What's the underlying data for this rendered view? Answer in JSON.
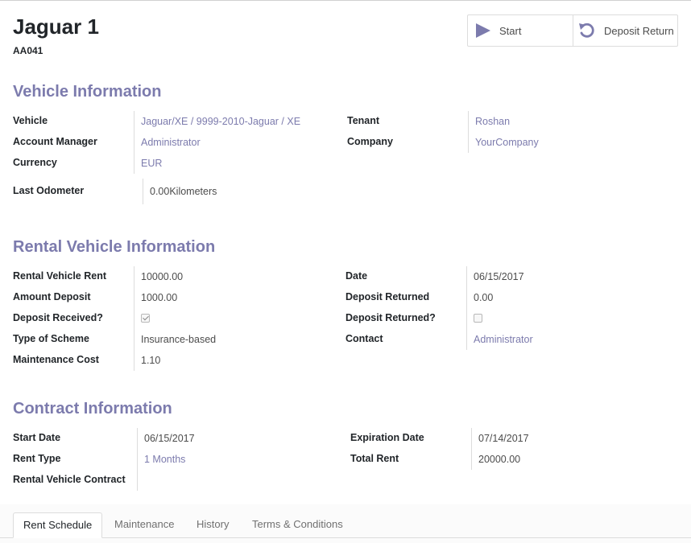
{
  "header": {
    "title": "Jaguar 1",
    "reference": "AA041"
  },
  "buttons": {
    "start_label": "Start",
    "deposit_return_label": "Deposit Return"
  },
  "colors": {
    "accent": "#7c7bad",
    "text": "#4c4c4c",
    "heading": "#212529"
  },
  "vehicle_info": {
    "heading": "Vehicle Information",
    "vehicle_label": "Vehicle",
    "vehicle_value": "Jaguar/XE / 9999-2010-Jaguar / XE",
    "account_manager_label": "Account Manager",
    "account_manager_value": "Administrator",
    "currency_label": "Currency",
    "currency_value": "EUR",
    "tenant_label": "Tenant",
    "tenant_value": "Roshan",
    "company_label": "Company",
    "company_value": "YourCompany",
    "odometer_label": "Last Odometer",
    "odometer_value": "0.00",
    "odometer_unit": "Kilometers"
  },
  "rental_info": {
    "heading": "Rental Vehicle Information",
    "rent_label": "Rental Vehicle Rent",
    "rent_value": "10000.00",
    "amount_deposit_label": "Amount Deposit",
    "amount_deposit_value": "1000.00",
    "deposit_received_label": "Deposit Received?",
    "deposit_received_checked": true,
    "scheme_label": "Type of Scheme",
    "scheme_value": "Insurance-based",
    "maintenance_cost_label": "Maintenance Cost",
    "maintenance_cost_value": "1.10",
    "date_label": "Date",
    "date_value": "06/15/2017",
    "deposit_returned_amt_label": "Deposit Returned",
    "deposit_returned_amt_value": "0.00",
    "deposit_returned_q_label": "Deposit Returned?",
    "deposit_returned_checked": false,
    "contact_label": "Contact",
    "contact_value": "Administrator"
  },
  "contract_info": {
    "heading": "Contract Information",
    "start_date_label": "Start Date",
    "start_date_value": "06/15/2017",
    "rent_type_label": "Rent Type",
    "rent_type_value": "1 Months",
    "contract_label": "Rental Vehicle Contract",
    "contract_value": "",
    "expiration_label": "Expiration Date",
    "expiration_value": "07/14/2017",
    "total_rent_label": "Total Rent",
    "total_rent_value": "20000.00"
  },
  "tabs": [
    {
      "label": "Rent Schedule",
      "active": true
    },
    {
      "label": "Maintenance",
      "active": false
    },
    {
      "label": "History",
      "active": false
    },
    {
      "label": "Terms & Conditions",
      "active": false
    }
  ]
}
